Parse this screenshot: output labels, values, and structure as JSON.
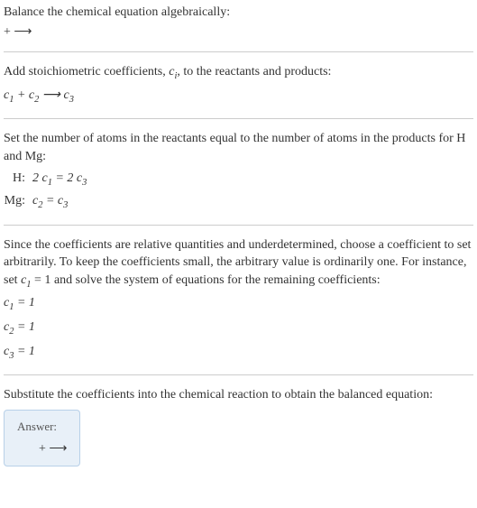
{
  "section1": {
    "title": "Balance the chemical equation algebraically:",
    "eq": " + ⟶ "
  },
  "section2": {
    "title_pre": "Add stoichiometric coefficients, ",
    "title_var": "c",
    "title_sub": "i",
    "title_post": ", to the reactants and products:",
    "eq_c1": "c",
    "eq_c1_sub": "1",
    "eq_plus": " + ",
    "eq_c2": "c",
    "eq_c2_sub": "2",
    "eq_arrow": " ⟶ ",
    "eq_c3": "c",
    "eq_c3_sub": "3"
  },
  "section3": {
    "title": "Set the number of atoms in the reactants equal to the number of atoms in the products for H and Mg:",
    "rows": [
      {
        "label": "H:",
        "lhs_coef": "2 ",
        "lhs_c": "c",
        "lhs_sub": "1",
        "eq": " = ",
        "rhs_coef": "2 ",
        "rhs_c": "c",
        "rhs_sub": "3"
      },
      {
        "label": "Mg:",
        "lhs_coef": "",
        "lhs_c": "c",
        "lhs_sub": "2",
        "eq": " = ",
        "rhs_coef": "",
        "rhs_c": "c",
        "rhs_sub": "3"
      }
    ]
  },
  "section4": {
    "title_pre": "Since the coefficients are relative quantities and underdetermined, choose a coefficient to set arbitrarily. To keep the coefficients small, the arbitrary value is ordinarily one. For instance, set ",
    "title_c": "c",
    "title_sub": "1",
    "title_mid": " = 1",
    "title_post": " and solve the system of equations for the remaining coefficients:",
    "lines": [
      {
        "c": "c",
        "sub": "1",
        "val": " = 1"
      },
      {
        "c": "c",
        "sub": "2",
        "val": " = 1"
      },
      {
        "c": "c",
        "sub": "3",
        "val": " = 1"
      }
    ]
  },
  "section5": {
    "title": "Substitute the coefficients into the chemical reaction to obtain the balanced equation:",
    "answer_label": "Answer:",
    "answer_eq": " + ⟶ "
  }
}
